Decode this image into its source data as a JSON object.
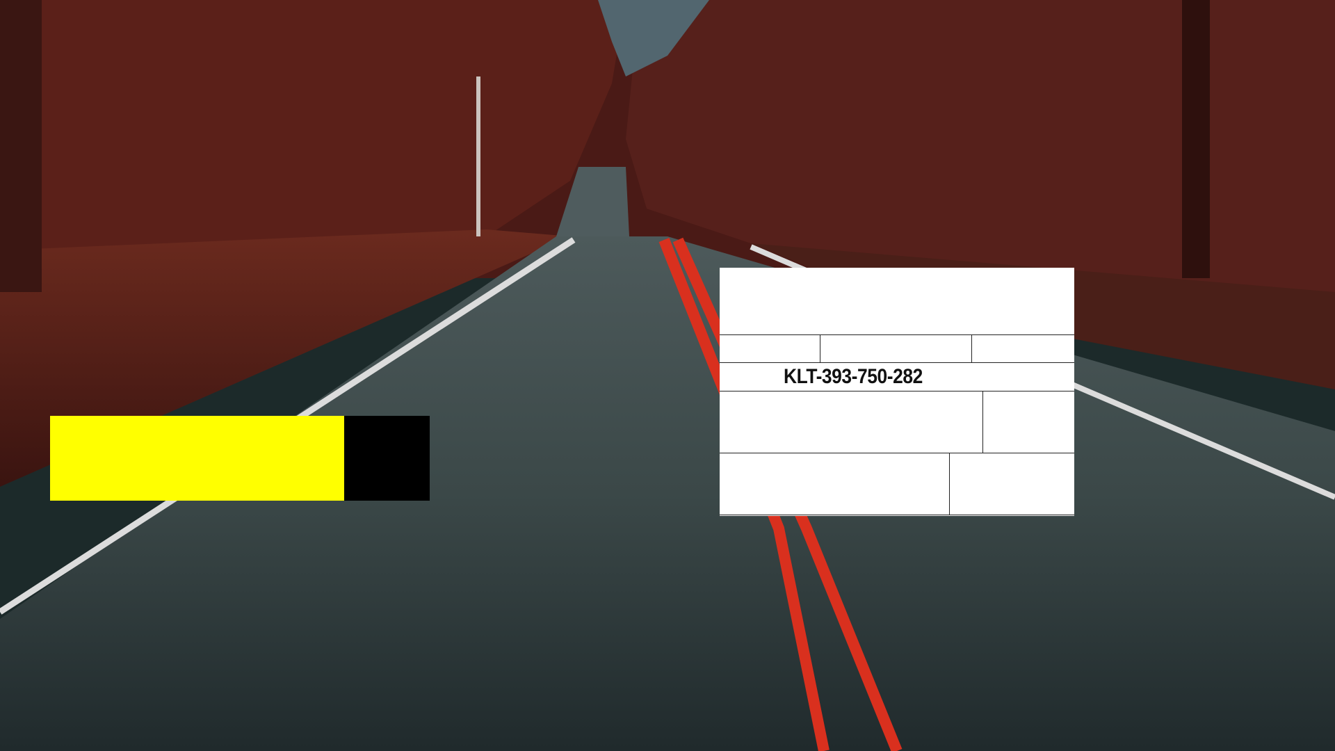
{
  "background": {
    "description_icon": "forest-road-photo",
    "sky_color": "#5a6f7a",
    "tree_color": "#5a1e18",
    "road_color": "#3c4a4a",
    "center_line_color": "#e02a1a",
    "edge_line_color": "#e8e8e8"
  },
  "progress": {
    "fill_fraction": 0.775,
    "fill_color": "#ffff00",
    "rest_color": "#000000"
  },
  "label_card": {
    "code": "KLT-393-750-282"
  }
}
